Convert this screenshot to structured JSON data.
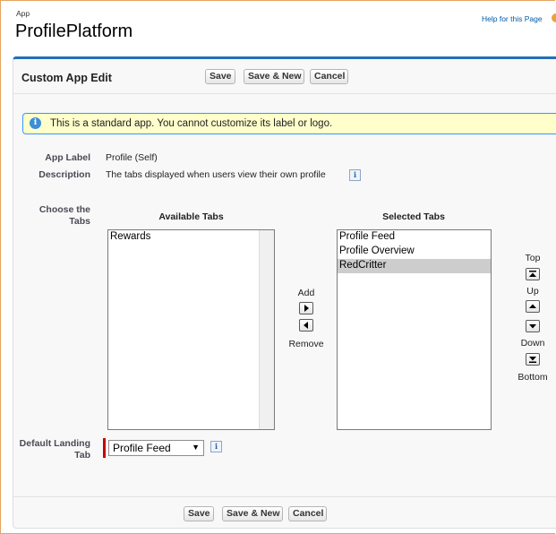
{
  "header": {
    "breadcrumb": "App",
    "title": "ProfilePlatform",
    "help_link": "Help for this Page"
  },
  "page_block": {
    "title": "Custom App Edit",
    "buttons": {
      "save": "Save",
      "save_new": "Save & New",
      "cancel": "Cancel"
    }
  },
  "message": {
    "text": "This is a standard app. You cannot customize its label or logo.",
    "icon": "info-icon"
  },
  "fields": {
    "app_label": {
      "label": "App Label",
      "value": "Profile (Self)"
    },
    "description": {
      "label": "Description",
      "value": "The tabs displayed when users view their own profile"
    },
    "choose_tabs_label": "Choose the Tabs",
    "available_header": "Available Tabs",
    "selected_header": "Selected Tabs",
    "available_tabs": [
      "Rewards"
    ],
    "selected_tabs": [
      "Profile Feed",
      "Profile Overview",
      "RedCritter"
    ],
    "selected_highlight": "RedCritter",
    "add_label": "Add",
    "remove_label": "Remove",
    "order": {
      "top": "Top",
      "up": "Up",
      "down": "Down",
      "bottom": "Bottom"
    },
    "default_landing": {
      "label": "Default Landing Tab",
      "value": "Profile Feed"
    }
  },
  "colors": {
    "accent": "#236fbd",
    "required": "#cc0000",
    "message_bg": "#ffffcc"
  }
}
